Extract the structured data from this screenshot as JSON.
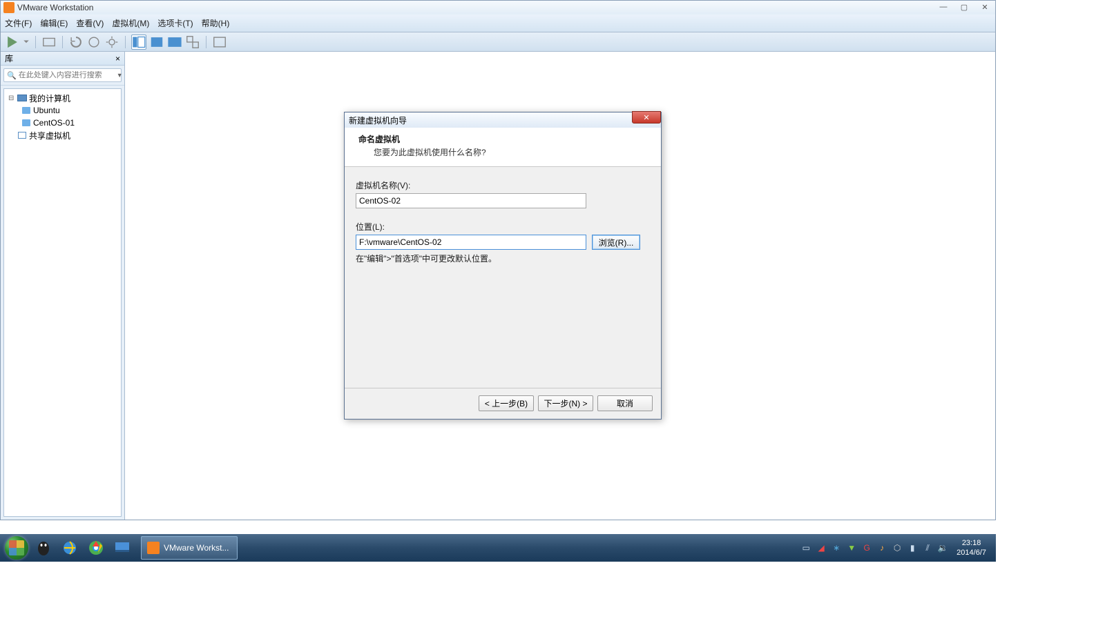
{
  "app": {
    "title": "VMware Workstation"
  },
  "menu": {
    "file": "文件(F)",
    "edit": "编辑(E)",
    "view": "查看(V)",
    "vm": "虚拟机(M)",
    "tabs": "选项卡(T)",
    "help": "帮助(H)"
  },
  "sidebar": {
    "title": "库",
    "close_x": "×",
    "search_placeholder": "在此处键入内容进行搜索",
    "root": "我的计算机",
    "items": [
      "Ubuntu",
      "CentOS-01"
    ],
    "shared": "共享虚拟机"
  },
  "dialog": {
    "title": "新建虚拟机向导",
    "heading": "命名虚拟机",
    "subheading": "您要为此虚拟机使用什么名称?",
    "name_label": "虚拟机名称(V):",
    "name_value": "CentOS-02",
    "location_label": "位置(L):",
    "location_value": "F:\\vmware\\CentOS-02",
    "browse": "浏览(R)...",
    "hint": "在\"编辑\">\"首选项\"中可更改默认位置。",
    "back": "< 上一步(B)",
    "next": "下一步(N) >",
    "cancel": "取消"
  },
  "taskbar": {
    "active_app": "VMware Workst...",
    "clock_time": "23:18",
    "clock_date": "2014/6/7"
  },
  "window_controls": {
    "min": "—",
    "max": "▢",
    "close": "✕"
  }
}
